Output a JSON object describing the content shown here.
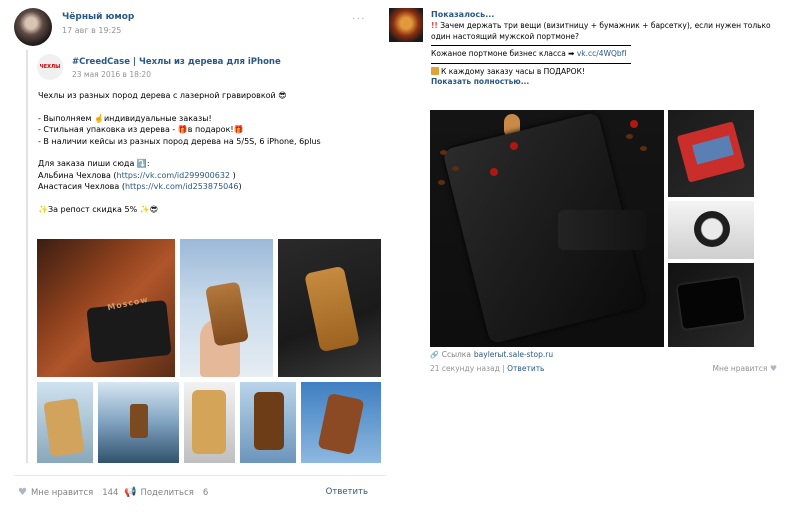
{
  "left_post": {
    "author": "Чёрный юмор",
    "date": "17 авг в 19:25",
    "more": "···",
    "repost": {
      "logo_text": "ЧЕХЛЫ",
      "author": "#CreedCase | Чехлы из дерева для iPhone",
      "date": "23 мая 2016 в 18:20",
      "lines": [
        "Чехлы из разных пород дерева с лазерной гравировкой 😎",
        "",
        "- Выполняем ☝️индивидуальные заказы!",
        "- Стильная упаковка из дерева - 🎁в подарок!🎁",
        "- В наличии кейсы из разных пород дерева на 5/5S, 6 iPhone, 6plus",
        "",
        "Для заказа пиши сюда ⤵️:",
        "Альбина Чехлова (https://vk.com/id299900632 )",
        "Анастасия Чехлова (https://vk.com/id253875046)",
        "",
        "✨За репост скидка 5% ✨😎"
      ],
      "contact1_name": "Альбина Чехлова (",
      "contact1_link": "https://vk.com/id299900632",
      "contact1_tail": " )",
      "contact2_name": "Анастасия Чехлова (",
      "contact2_link": "https://vk.com/id253875046",
      "contact2_tail": ")",
      "photo_text": "Moscow"
    },
    "footer": {
      "likes_label": "Мне нравится",
      "likes_count": "144",
      "share_label": "Поделиться",
      "share_count": "6",
      "reply_label": "Ответить"
    }
  },
  "right_post": {
    "author": "Показалось...",
    "line1": "Зачем держать три вещи (визитницу + бумажник + барсетку), если нужен только один настоящий мужской портмоне?",
    "line2_prefix": "Кожаное портмоне бизнес класса ➡ ",
    "line2_link": "vk.cc/4WQbfI",
    "line3": "К каждому заказу часы в ПОДАРОК!",
    "show_more": "Показать полностью...",
    "link_label": "Ссылка",
    "link_url": "baylerыt.sale-stop.ru",
    "time": "21 секунду назад",
    "reply_label": "Ответить",
    "like_label": "Мне нравится"
  },
  "colors": {
    "link": "#2a5885",
    "muted": "#939393",
    "divider": "#e7e8ec"
  },
  "icons": {
    "like": "heart-icon",
    "share": "megaphone-icon",
    "more": "ellipsis-icon",
    "link": "link-icon"
  }
}
